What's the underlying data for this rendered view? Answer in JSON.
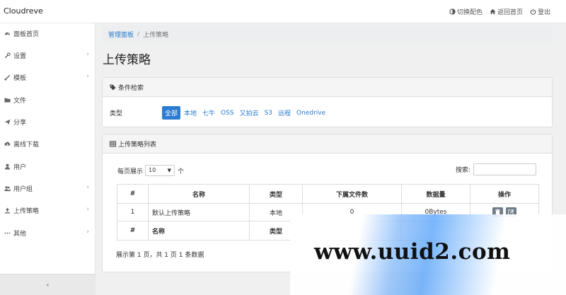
{
  "app": {
    "brand": "Cloudreve"
  },
  "topbar": {
    "theme_label": "切换配色",
    "home_label": "返回首页",
    "logout_label": "登出"
  },
  "sidebar": {
    "items": [
      {
        "label": "面板首页",
        "icon": "dashboard-icon",
        "has_children": false
      },
      {
        "label": "设置",
        "icon": "wrench-icon",
        "has_children": true
      },
      {
        "label": "模板",
        "icon": "brush-icon",
        "has_children": true
      },
      {
        "label": "文件",
        "icon": "folder-icon",
        "has_children": false
      },
      {
        "label": "分享",
        "icon": "send-icon",
        "has_children": false
      },
      {
        "label": "离线下载",
        "icon": "cloud-download-icon",
        "has_children": false
      },
      {
        "label": "用户",
        "icon": "user-icon",
        "has_children": false
      },
      {
        "label": "用户组",
        "icon": "users-icon",
        "has_children": true
      },
      {
        "label": "上传策略",
        "icon": "upload-icon",
        "has_children": true
      },
      {
        "label": "其他",
        "icon": "ellipsis-icon",
        "has_children": true
      }
    ],
    "collapse_glyph": "‹"
  },
  "breadcrumb": {
    "parent": "管理面板",
    "separator": "/",
    "current": "上传策略"
  },
  "page_title": "上传策略",
  "filter_panel": {
    "title": "条件检索",
    "type_label": "类型",
    "chips": [
      "全部",
      "本地",
      "七牛",
      "OSS",
      "又拍云",
      "S3",
      "远程",
      "Onedrive"
    ],
    "active_chip": "全部"
  },
  "list_panel": {
    "title": "上传策略列表",
    "per_page_prefix": "每页展示",
    "per_page_value": "10",
    "per_page_suffix": "个",
    "search_label": "搜索:",
    "columns": [
      "#",
      "名称",
      "类型",
      "下属文件数",
      "数据量",
      "操作"
    ],
    "rows": [
      {
        "id": "1",
        "name": "默认上传策略",
        "type": "本地",
        "files": "0",
        "size": "0Bytes"
      }
    ],
    "footer_columns": [
      "#",
      "名称",
      "类型"
    ],
    "info": "展示第 1 页，共 1 页 1 条数据"
  },
  "watermark": {
    "text": "www.uuid2.com"
  },
  "colors": {
    "accent": "#2b7bd0",
    "panel_head": "#f5f5f5",
    "button": "#6e7b86"
  }
}
